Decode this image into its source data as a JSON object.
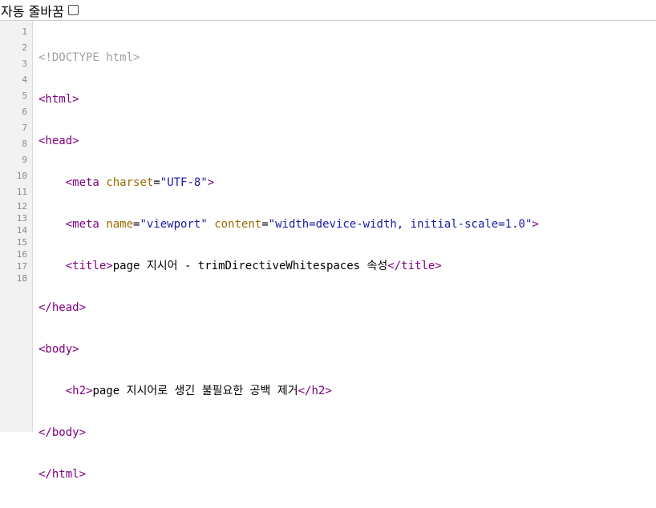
{
  "toolbar": {
    "wrap_label": "자동 줄바꿈",
    "wrap_checked": false
  },
  "gutter": {
    "line_numbers": [
      "1",
      "2",
      "3",
      "4",
      "5",
      "6",
      "7",
      "8",
      "9",
      "10",
      "11",
      "12",
      "13",
      "14",
      "15",
      "16",
      "17",
      "18"
    ]
  },
  "code": {
    "l1": "<!DOCTYPE html>",
    "l2_tag": "<html>",
    "l3_tag": "<head>",
    "l4_open": "<meta",
    "l4_attr": "charset",
    "l4_eq": "=",
    "l4_val": "\"UTF-8\"",
    "l4_close": ">",
    "l5_open": "<meta",
    "l5_attr1": "name",
    "l5_eq1": "=",
    "l5_val1": "\"viewport\"",
    "l5_attr2": "content",
    "l5_eq2": "=",
    "l5_val2": "\"width=device-width, initial-scale=1.0\"",
    "l5_close": ">",
    "l6_open": "<title>",
    "l6_text": "page 지시어 - trimDirectiveWhitespaces 속성",
    "l6_close": "</title>",
    "l7_tag": "</head>",
    "l8_tag": "<body>",
    "l9_open": "<h2>",
    "l9_text": "page 지시어로 생긴 불필요한 공백 제거",
    "l9_close": "</h2>",
    "l10_tag": "</body>",
    "l11_tag": "</html>"
  }
}
